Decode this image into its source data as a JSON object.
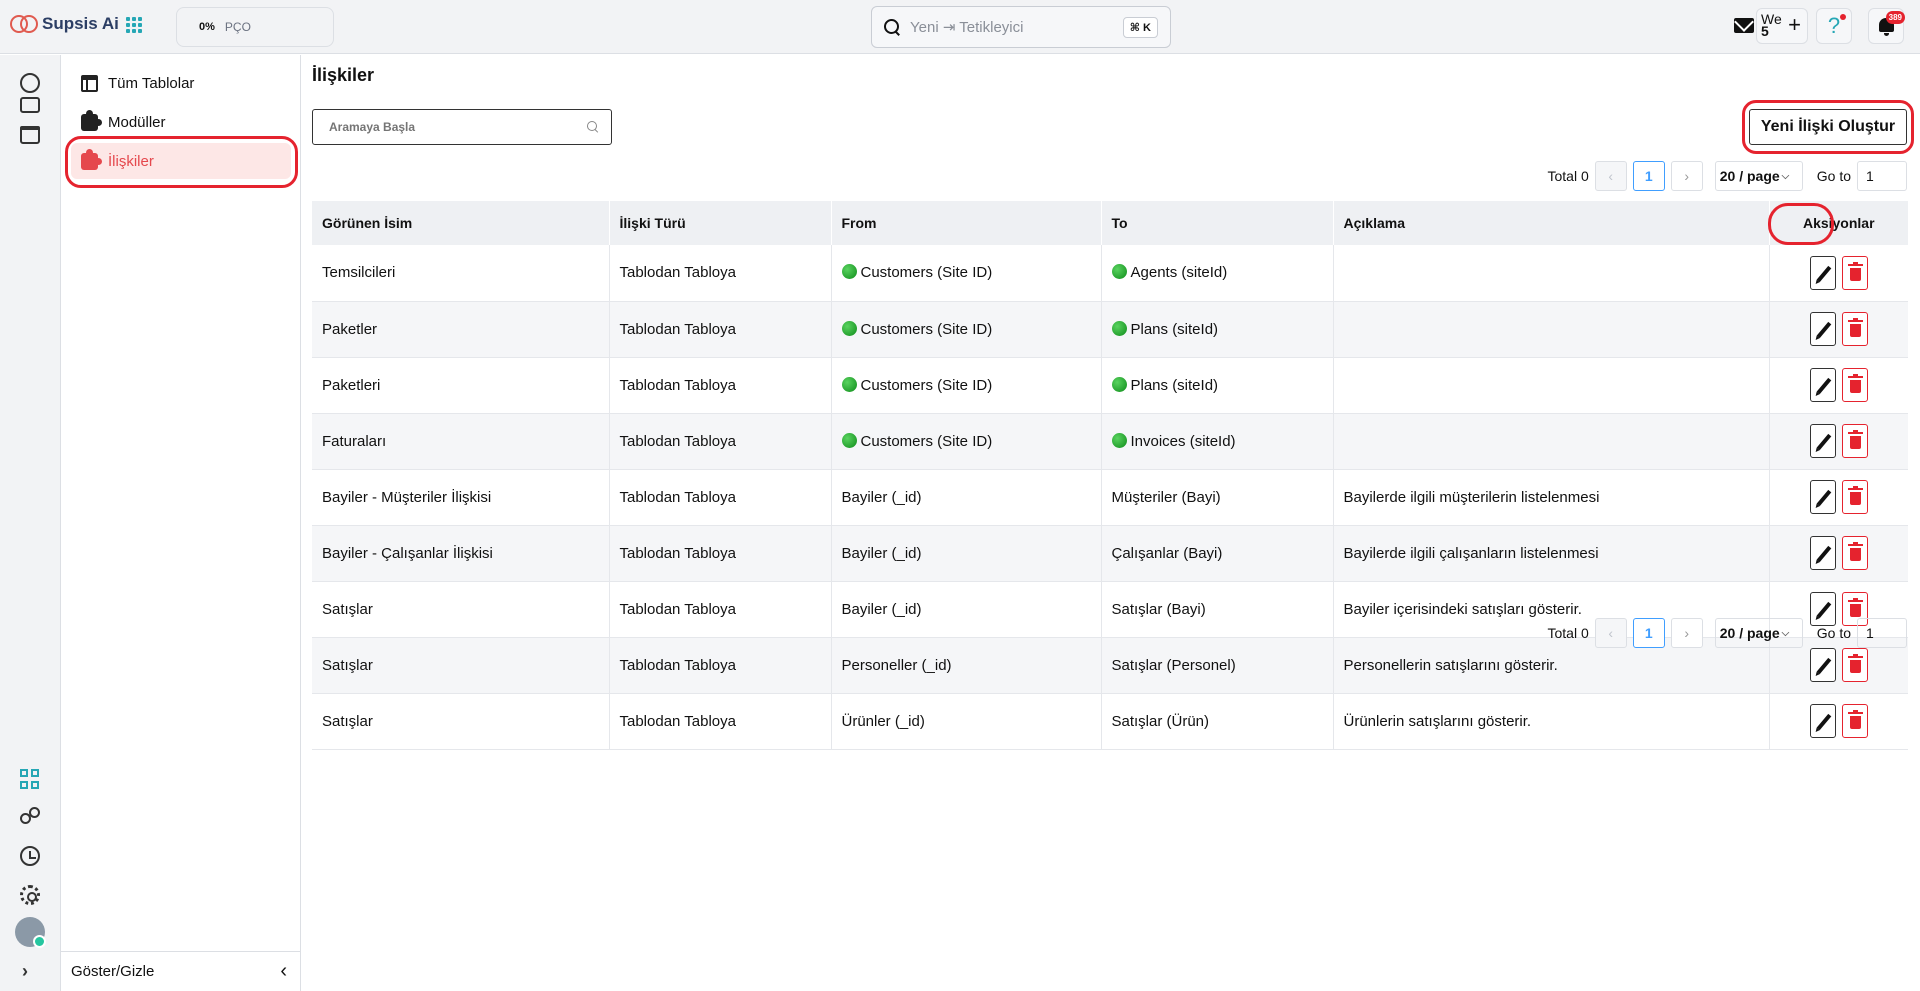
{
  "app": {
    "name": "Supsis Ai",
    "progress_percent": "0%",
    "progress_label": "PÇO"
  },
  "topbar": {
    "search_placeholder": "Yeni ⇥ Tetikleyici",
    "search_shortcut": "⌘ K",
    "workspace_label": "We",
    "workspace_count": "5",
    "help_label": "?",
    "notification_count": "389"
  },
  "sidebar": {
    "items": [
      {
        "label": "Tüm Tablolar"
      },
      {
        "label": "Modüller"
      },
      {
        "label": "İlişkiler"
      }
    ],
    "toggle_label": "Göster/Gizle"
  },
  "page": {
    "title": "İlişkiler",
    "search_placeholder": "Aramaya Başla",
    "create_button": "Yeni İlişki Oluştur"
  },
  "pagination": {
    "total_label": "Total 0",
    "current_page": "1",
    "page_size": "20 / page",
    "goto_label": "Go to",
    "goto_value": "1"
  },
  "table": {
    "columns": [
      "Görünen İsim",
      "İlişki Türü",
      "From",
      "To",
      "Açıklama",
      "Aksiyonlar"
    ],
    "rows": [
      {
        "name": "Temsilcileri",
        "type": "Tablodan Tabloya",
        "from": "Customers (Site ID)",
        "to": "Agents (siteId)",
        "desc": ""
      },
      {
        "name": "Paketler",
        "type": "Tablodan Tabloya",
        "from": "Customers (Site ID)",
        "to": "Plans (siteId)",
        "desc": ""
      },
      {
        "name": "Paketleri",
        "type": "Tablodan Tabloya",
        "from": "Customers (Site ID)",
        "to": "Plans (siteId)",
        "desc": ""
      },
      {
        "name": "Faturaları",
        "type": "Tablodan Tabloya",
        "from": "Customers (Site ID)",
        "to": "Invoices (siteId)",
        "desc": ""
      },
      {
        "name": "Bayiler - Müşteriler İlişkisi",
        "type": "Tablodan Tabloya",
        "from": "Bayiler (_id)",
        "to": "Müşteriler (Bayi)",
        "desc": "Bayilerde ilgili müşterilerin listelenmesi"
      },
      {
        "name": "Bayiler - Çalışanlar İlişkisi",
        "type": "Tablodan Tabloya",
        "from": "Bayiler (_id)",
        "to": "Çalışanlar (Bayi)",
        "desc": "Bayilerde ilgili çalışanların listelenmesi"
      },
      {
        "name": "Satışlar",
        "type": "Tablodan Tabloya",
        "from": "Bayiler (_id)",
        "to": "Satışlar (Bayi)",
        "desc": "Bayiler içerisindeki satışları gösterir."
      },
      {
        "name": "Satışlar",
        "type": "Tablodan Tabloya",
        "from": "Personeller (_id)",
        "to": "Satışlar (Personel)",
        "desc": "Personellerin satışlarını gösterir."
      },
      {
        "name": "Satışlar",
        "type": "Tablodan Tabloya",
        "from": "Ürünler (_id)",
        "to": "Satışlar (Ürün)",
        "desc": "Ürünlerin satışlarını gösterir."
      }
    ]
  },
  "colors": {
    "accent": "#e5484d",
    "teal": "#26a7b5",
    "highlight_ring": "#e5232e"
  }
}
